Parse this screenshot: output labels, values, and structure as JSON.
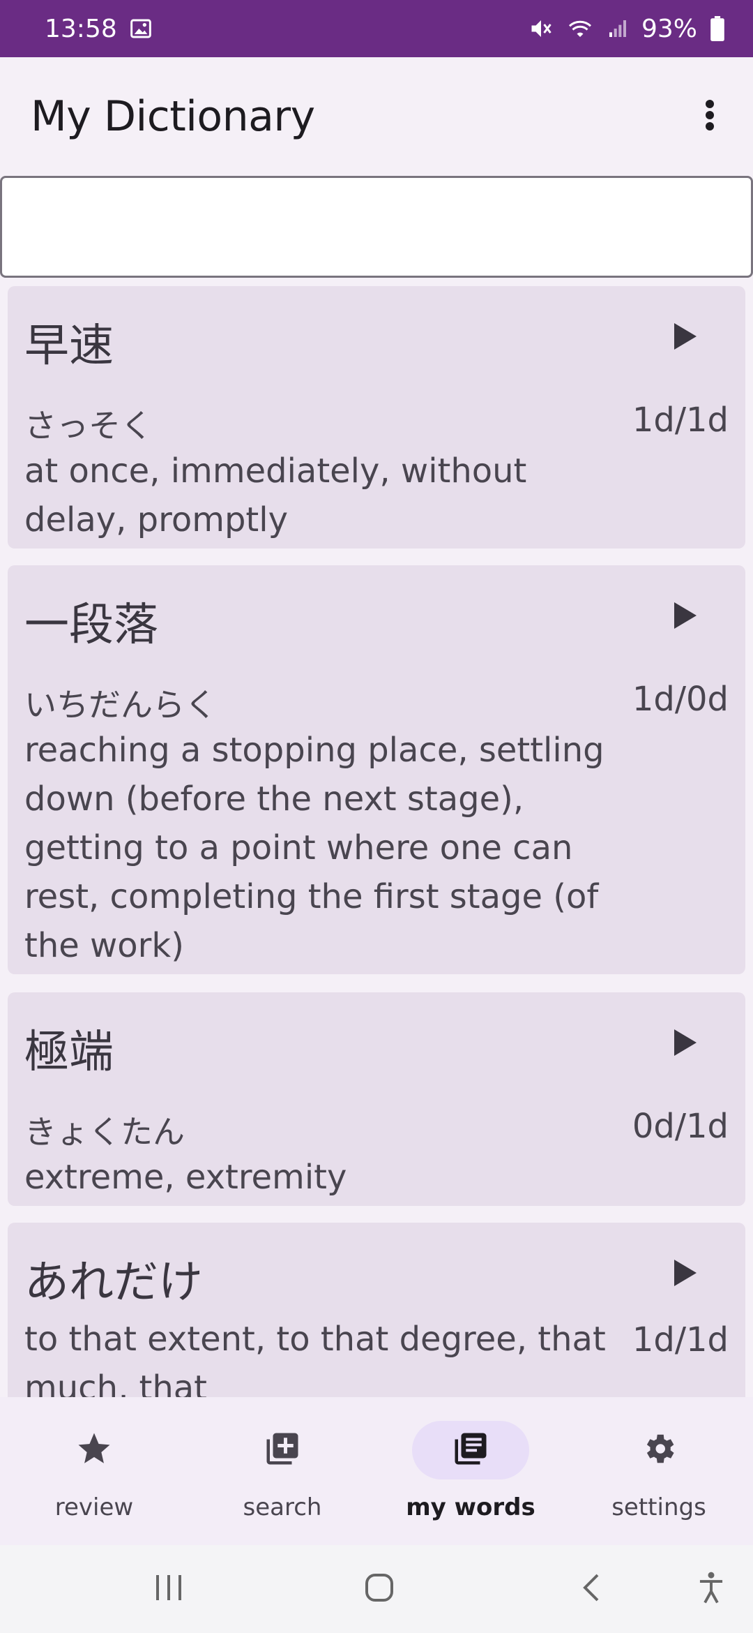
{
  "status_bar": {
    "time": "13:58",
    "battery": "93%",
    "icons": [
      "image-icon",
      "mute-icon",
      "wifi-icon",
      "signal-icon",
      "battery-icon"
    ]
  },
  "app_bar": {
    "title": "My Dictionary",
    "menu_icon": "more-vert-icon"
  },
  "search": {
    "value": "",
    "placeholder": ""
  },
  "words": [
    {
      "kanji": "早速",
      "reading": "さっそく",
      "ratio": "1d/1d",
      "meaning": "at once, immediately, without delay, promptly"
    },
    {
      "kanji": "一段落",
      "reading": "いちだんらく",
      "ratio": "1d/0d",
      "meaning": "reaching a stopping place, settling down (before the next stage), getting to a point where one can rest, completing the first stage (of the work)"
    },
    {
      "kanji": "極端",
      "reading": "きょくたん",
      "ratio": "0d/1d",
      "meaning": "extreme, extremity"
    },
    {
      "kanji": "あれだけ",
      "reading": "",
      "ratio": "1d/1d",
      "meaning": "to that extent, to that degree, that much, that"
    }
  ],
  "bottom_nav": {
    "items": [
      {
        "label": "review",
        "icon": "star-icon",
        "active": false
      },
      {
        "label": "search",
        "icon": "add-box-icon",
        "active": false
      },
      {
        "label": "my words",
        "icon": "library-books-icon",
        "active": true
      },
      {
        "label": "settings",
        "icon": "gear-icon",
        "active": false
      }
    ]
  },
  "system_nav": {
    "icons": [
      "recents-icon",
      "home-icon",
      "back-icon",
      "accessibility-icon"
    ]
  },
  "colors": {
    "status_bar": "#6a2c84",
    "card_bg": "#e7deeb",
    "active_pill": "#e8def8",
    "text_primary": "#1d1b20",
    "text_secondary": "#49454f"
  }
}
